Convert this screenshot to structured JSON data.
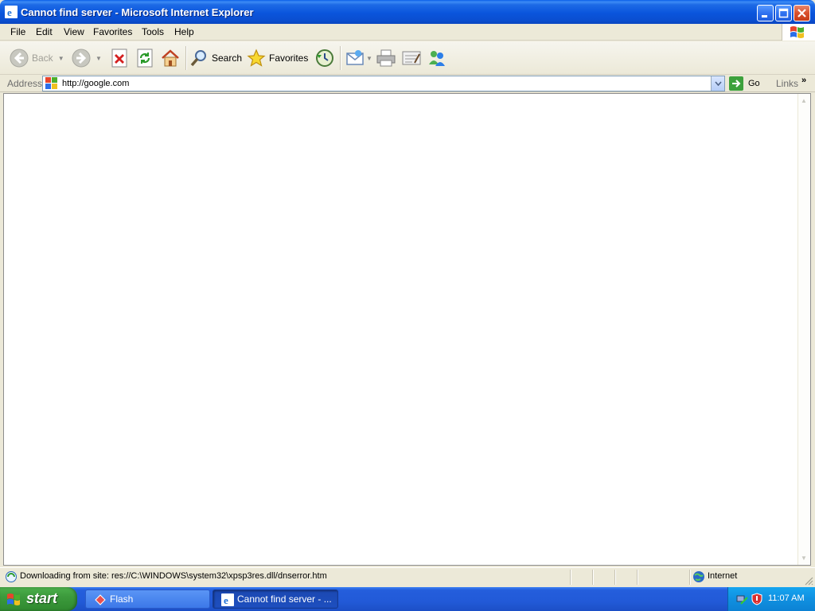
{
  "window": {
    "title": "Cannot find server - Microsoft Internet Explorer"
  },
  "menubar": {
    "items": [
      "File",
      "Edit",
      "View",
      "Favorites",
      "Tools",
      "Help"
    ]
  },
  "toolbar": {
    "back_label": "Back",
    "search_label": "Search",
    "favorites_label": "Favorites"
  },
  "address": {
    "label": "Address",
    "value": "http://google.com",
    "go_label": "Go",
    "links_label": "Links"
  },
  "status": {
    "text": "Downloading from site: res://C:\\WINDOWS\\system32\\xpsp3res.dll/dnserror.htm",
    "zone": "Internet"
  },
  "taskbar": {
    "start_label": "start",
    "tasks": [
      {
        "label": "Flash"
      },
      {
        "label": "Cannot find server - ..."
      }
    ],
    "clock": "11:07 AM"
  },
  "colors": {
    "titlebar": "#0a55dc",
    "taskbar": "#245edc",
    "start": "#3c9a3c",
    "tray": "#1090e0"
  }
}
